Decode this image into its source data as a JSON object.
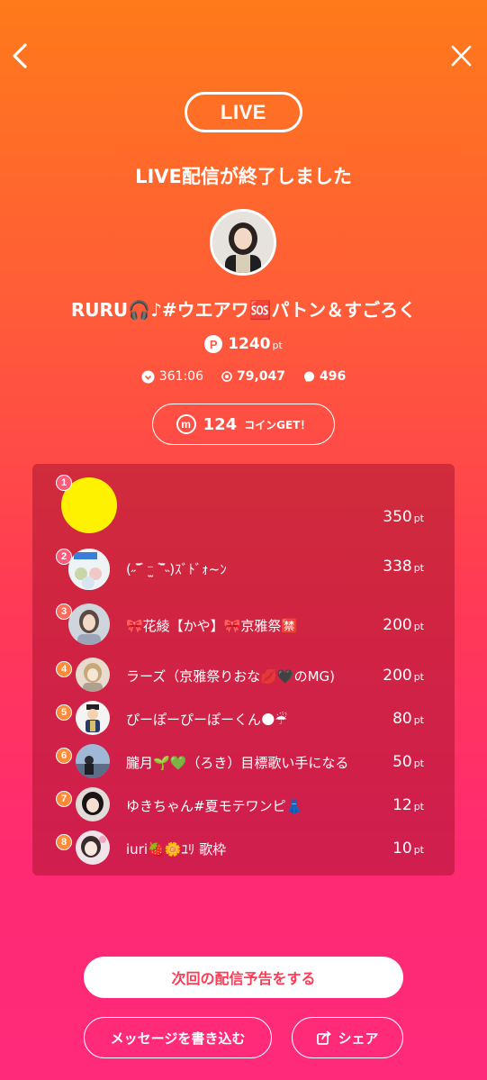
{
  "header": {
    "live_badge": "LIVE",
    "ended_title": "LIVE配信が終了しました"
  },
  "stream": {
    "title": "RURU🎧♪#ウエアワ🆘パトン＆すごろく",
    "points_icon": "P",
    "points": "1240",
    "points_unit": "pt"
  },
  "stats": {
    "duration": "361:06",
    "views": "79,047",
    "comments": "496"
  },
  "coins": {
    "icon": "m",
    "value": "124",
    "label": "コインGET！"
  },
  "ranking": [
    {
      "rank": "1",
      "name": "",
      "points": "350",
      "unit": "pt"
    },
    {
      "rank": "2",
      "name": "(˶‾᷄ ⁻̫ ‾᷅˵)ｽﾞﾄﾞｫ~ﾝ",
      "points": "338",
      "unit": "pt"
    },
    {
      "rank": "3",
      "name": "🎀花綾【かや】🎀京雅祭🈲",
      "points": "200",
      "unit": "pt"
    },
    {
      "rank": "4",
      "name": "ラーズ（京雅祭りおな💋🖤のMG)",
      "points": "200",
      "unit": "pt"
    },
    {
      "rank": "5",
      "name": "ぴーぽーぴーぽーくん🌑☔",
      "points": "80",
      "unit": "pt"
    },
    {
      "rank": "6",
      "name": "朧月🌱💚（ろき）目標歌い手になる",
      "points": "50",
      "unit": "pt"
    },
    {
      "rank": "7",
      "name": "ゆきちゃん#夏モテワンピ👗",
      "points": "12",
      "unit": "pt"
    },
    {
      "rank": "8",
      "name": "iuri🍓🌼ﾕﾘ 歌枠",
      "points": "10",
      "unit": "pt"
    }
  ],
  "buttons": {
    "schedule": "次回の配信予告をする",
    "message": "メッセージを書き込む",
    "share": "シェア"
  }
}
